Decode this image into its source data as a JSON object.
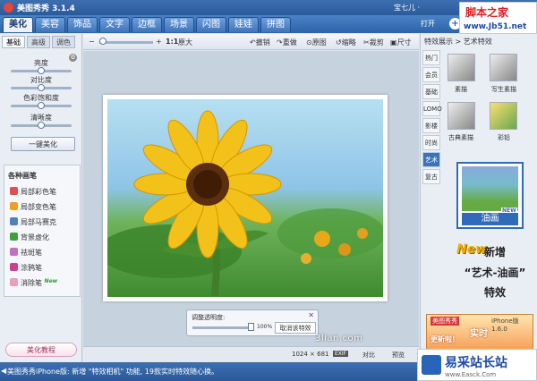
{
  "titlebar": {
    "app_title": "美图秀秀 3.1.4",
    "user": "宝七儿 ·"
  },
  "menu": {
    "tabs": [
      "美化",
      "美容",
      "饰品",
      "文字",
      "边框",
      "场景",
      "闪图",
      "娃娃",
      "拼图"
    ],
    "open_label": "打开"
  },
  "watermark_top": {
    "line1": "脚本之家",
    "line2": "www.Jb51.net"
  },
  "left": {
    "subtabs": [
      "基础",
      "高级",
      "调色"
    ],
    "sliders": [
      {
        "label": "亮度",
        "value": 0.5
      },
      {
        "label": "对比度",
        "value": 0.5
      },
      {
        "label": "色彩饱和度",
        "value": 0.5
      },
      {
        "label": "清晰度",
        "value": 0.5
      }
    ],
    "one_key": "一键美化",
    "brush_header": "各种画笔",
    "brushes": [
      {
        "label": "局部彩色笔",
        "color": "#e05050",
        "new": ""
      },
      {
        "label": "局部变色笔",
        "color": "#f0a020",
        "new": ""
      },
      {
        "label": "局部马赛克",
        "color": "#5080c0",
        "new": ""
      },
      {
        "label": "背景虚化",
        "color": "#40a040",
        "new": ""
      },
      {
        "label": "祛斑笔",
        "color": "#c070c0",
        "new": ""
      },
      {
        "label": "涂鸦笔",
        "color": "#d04090",
        "new": ""
      },
      {
        "label": "消除笔",
        "color": "#e8a0c0",
        "new": "New"
      }
    ],
    "tutorial": "美化教程"
  },
  "toolbar": {
    "ratio": "1:1",
    "fit": "原大",
    "undo": "撤销",
    "redo": "重做",
    "reset": "原图",
    "compare": "缩略",
    "crop": "裁剪",
    "size": "尺寸"
  },
  "adjust": {
    "label": "调整透明度:",
    "percent": "100%",
    "cancel": "取消该特效",
    "opacity": 1.0
  },
  "status": {
    "dims": "1024 × 681",
    "exif": "EXIF",
    "compare": "对比",
    "preview": "预览"
  },
  "site_watermark": "3lian.com",
  "right": {
    "title": "特效展示 > 艺术特效",
    "categories": [
      "热门",
      "会员",
      "基础",
      "LOMO",
      "影楼",
      "时尚",
      "艺术",
      "复古"
    ],
    "active_category": 6,
    "thumbs": [
      "素描",
      "写生素描",
      "古典素描",
      "彩铅"
    ],
    "selected": "油画",
    "selected_badge": "NEW",
    "promo": {
      "new": "New",
      "line1": "新增",
      "line2": "“艺术-油画”",
      "line3": "特效"
    },
    "banner": {
      "brand": "美图秀秀",
      "version": "iPhone版 1.6.0",
      "big": "实时",
      "sub": "更新啦!"
    }
  },
  "footer": {
    "message": "美图秀秀iPhone版: 新增 \"特效相机\" 功能, 19款实时特效随心换。"
  },
  "watermark_bottom": {
    "title": "易采站长站",
    "url": "www.Easck.Com"
  }
}
